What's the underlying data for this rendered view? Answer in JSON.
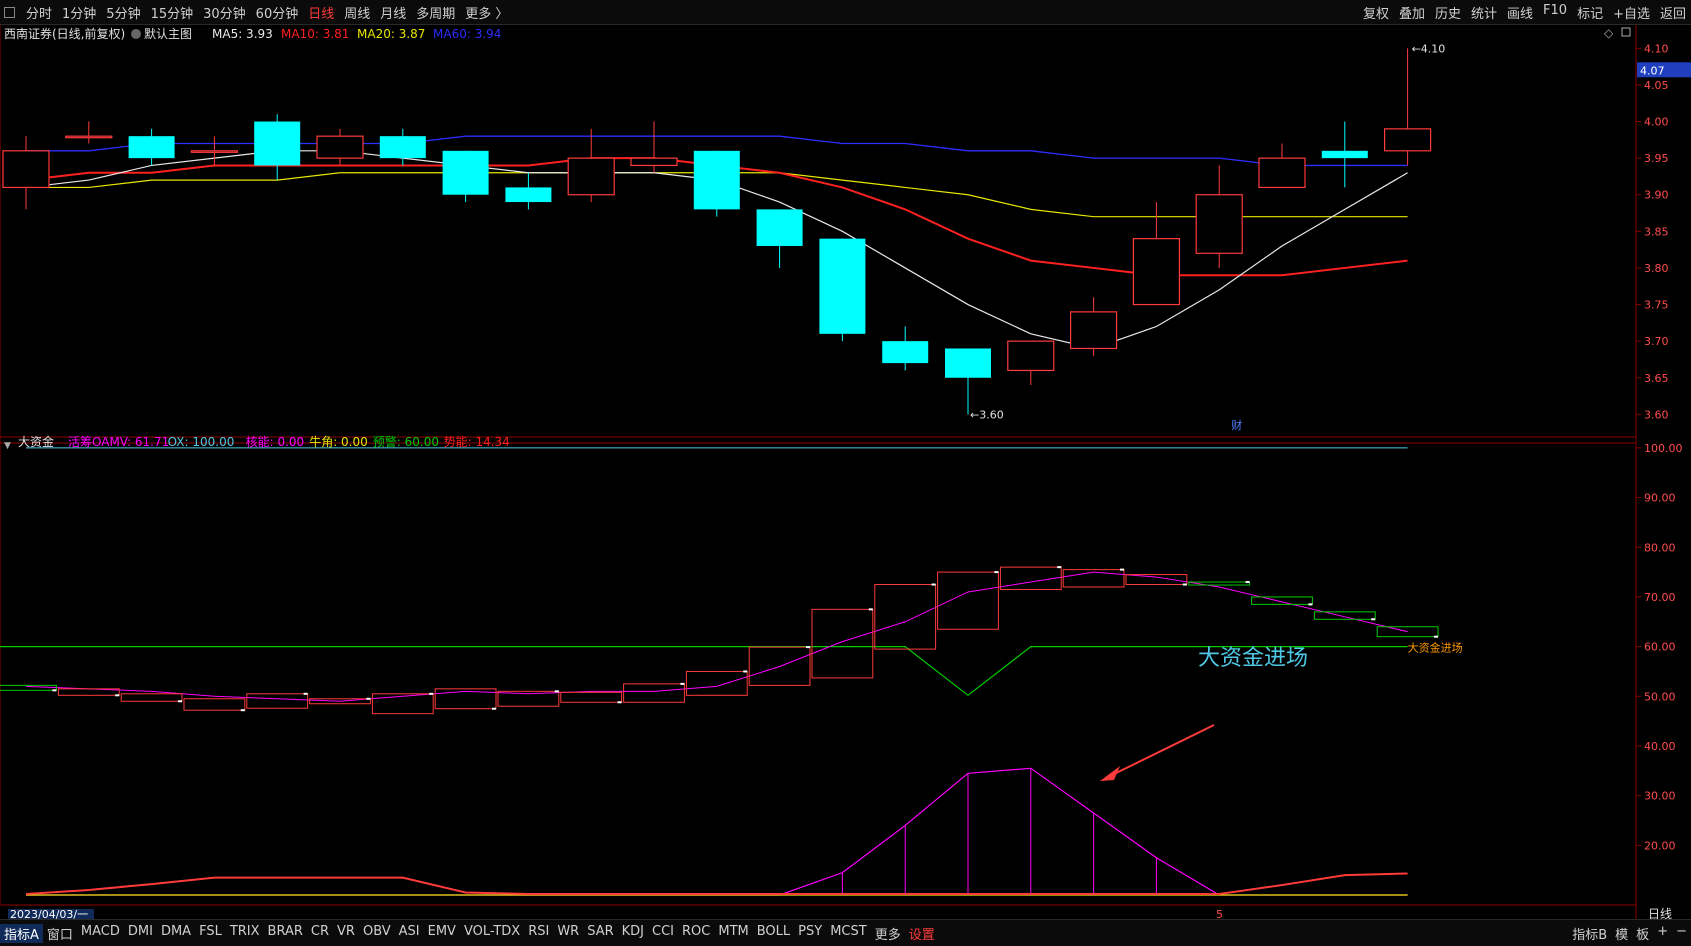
{
  "toolbar": {
    "periods": [
      "分时",
      "1分钟",
      "5分钟",
      "15分钟",
      "30分钟",
      "60分钟",
      "日线",
      "周线",
      "月线",
      "多周期",
      "更多 〉"
    ],
    "active_period": "日线",
    "right_buttons": [
      "复权",
      "叠加",
      "历史",
      "统计",
      "画线",
      "F10",
      "标记",
      "+自选",
      "返回"
    ]
  },
  "indicator_tabs": [
    "指标A",
    "窗口",
    "MACD",
    "DMI",
    "DMA",
    "FSL",
    "TRIX",
    "BRAR",
    "CR",
    "VR",
    "OBV",
    "ASI",
    "EMV",
    "VOL-TDX",
    "RSI",
    "WR",
    "SAR",
    "KDJ",
    "CCI",
    "ROC",
    "MTM",
    "BOLL",
    "PSY",
    "MCST",
    "更多",
    "设置"
  ],
  "bottom_right": [
    "指标B",
    "模",
    "板",
    "+",
    "−"
  ],
  "colors": {
    "up": "#ff3b3b",
    "down": "#00ffff",
    "ma5": "#e8e8e8",
    "ma10": "#ff2020",
    "ma20": "#e6e600",
    "ma60": "#2d2dff",
    "amv": "#ff00ff",
    "green": "#00cc00",
    "orange": "#ff9900",
    "cyanline": "#4fc8e6"
  },
  "chart_data": [
    {
      "type": "candlestick",
      "title": "西南证券(日线,前复权)",
      "subtitle": "默认主图",
      "legend": [
        {
          "name": "MA5",
          "value": "3.93",
          "color": "#e8e8e8"
        },
        {
          "name": "MA10",
          "value": "3.81",
          "color": "#ff2020"
        },
        {
          "name": "MA20",
          "value": "3.87",
          "color": "#e6e600"
        },
        {
          "name": "MA60",
          "value": "3.94",
          "color": "#2d2dff"
        }
      ],
      "ylim": [
        3.58,
        4.11
      ],
      "yticks": [
        "4.10",
        "4.05",
        "4.00",
        "3.95",
        "3.90",
        "3.85",
        "3.80",
        "3.75",
        "3.70",
        "3.65",
        "3.60"
      ],
      "last_price": "4.07",
      "high_label": "4.10",
      "low_label": "3.60",
      "marker": "财",
      "candles": [
        {
          "o": 3.91,
          "h": 3.98,
          "l": 3.88,
          "c": 3.96
        },
        {
          "o": 3.98,
          "h": 4.0,
          "l": 3.97,
          "c": 3.98
        },
        {
          "o": 3.98,
          "h": 3.99,
          "l": 3.94,
          "c": 3.95
        },
        {
          "o": 3.96,
          "h": 3.98,
          "l": 3.94,
          "c": 3.96
        },
        {
          "o": 4.0,
          "h": 4.01,
          "l": 3.92,
          "c": 3.94
        },
        {
          "o": 3.95,
          "h": 3.99,
          "l": 3.94,
          "c": 3.98
        },
        {
          "o": 3.98,
          "h": 3.99,
          "l": 3.94,
          "c": 3.95
        },
        {
          "o": 3.96,
          "h": 3.96,
          "l": 3.89,
          "c": 3.9
        },
        {
          "o": 3.91,
          "h": 3.93,
          "l": 3.88,
          "c": 3.89
        },
        {
          "o": 3.9,
          "h": 3.99,
          "l": 3.89,
          "c": 3.95
        },
        {
          "o": 3.94,
          "h": 4.0,
          "l": 3.93,
          "c": 3.95
        },
        {
          "o": 3.96,
          "h": 3.96,
          "l": 3.87,
          "c": 3.88
        },
        {
          "o": 3.88,
          "h": 3.88,
          "l": 3.8,
          "c": 3.83
        },
        {
          "o": 3.84,
          "h": 3.84,
          "l": 3.7,
          "c": 3.71
        },
        {
          "o": 3.7,
          "h": 3.72,
          "l": 3.66,
          "c": 3.67
        },
        {
          "o": 3.69,
          "h": 3.69,
          "l": 3.6,
          "c": 3.65
        },
        {
          "o": 3.66,
          "h": 3.7,
          "l": 3.64,
          "c": 3.7
        },
        {
          "o": 3.69,
          "h": 3.76,
          "l": 3.68,
          "c": 3.74
        },
        {
          "o": 3.75,
          "h": 3.89,
          "l": 3.75,
          "c": 3.84
        },
        {
          "o": 3.82,
          "h": 3.94,
          "l": 3.8,
          "c": 3.9
        },
        {
          "o": 3.91,
          "h": 3.97,
          "l": 3.91,
          "c": 3.95
        },
        {
          "o": 3.96,
          "h": 4.0,
          "l": 3.91,
          "c": 3.95
        },
        {
          "o": 3.96,
          "h": 4.1,
          "l": 3.94,
          "c": 3.99
        }
      ],
      "ma5": [
        3.91,
        3.92,
        3.94,
        3.95,
        3.96,
        3.96,
        3.95,
        3.94,
        3.93,
        3.93,
        3.93,
        3.92,
        3.89,
        3.85,
        3.8,
        3.75,
        3.71,
        3.69,
        3.72,
        3.77,
        3.83,
        3.88,
        3.93
      ],
      "ma10": [
        3.92,
        3.93,
        3.93,
        3.94,
        3.94,
        3.94,
        3.94,
        3.94,
        3.94,
        3.95,
        3.95,
        3.94,
        3.93,
        3.91,
        3.88,
        3.84,
        3.81,
        3.8,
        3.79,
        3.79,
        3.79,
        3.8,
        3.81
      ],
      "ma20": [
        3.91,
        3.91,
        3.92,
        3.92,
        3.92,
        3.93,
        3.93,
        3.93,
        3.93,
        3.93,
        3.93,
        3.93,
        3.93,
        3.92,
        3.91,
        3.9,
        3.88,
        3.87,
        3.87,
        3.87,
        3.87,
        3.87,
        3.87
      ],
      "ma60": [
        3.96,
        3.96,
        3.97,
        3.97,
        3.97,
        3.97,
        3.97,
        3.98,
        3.98,
        3.98,
        3.98,
        3.98,
        3.98,
        3.97,
        3.97,
        3.96,
        3.96,
        3.95,
        3.95,
        3.95,
        3.94,
        3.94,
        3.94
      ]
    },
    {
      "type": "indicator",
      "title": "大资金",
      "legend": [
        {
          "name": "活筹OAMV",
          "value": "61.71",
          "color": "#ff00ff"
        },
        {
          "name": "OX",
          "value": "100.00",
          "color": "#4fc8e6"
        },
        {
          "name": "核能",
          "value": "0.00",
          "color": "#ff00ff"
        },
        {
          "name": "牛角",
          "value": "0.00",
          "color": "#e6e600"
        },
        {
          "name": "预警",
          "value": "60.00",
          "color": "#00cc00"
        },
        {
          "name": "势能",
          "value": "14.34",
          "color": "#ff2020"
        }
      ],
      "ylim": [
        10,
        103
      ],
      "yticks": [
        "100.00",
        "90.00",
        "80.00",
        "70.00",
        "60.00",
        "50.00",
        "40.00",
        "30.00",
        "20.00"
      ],
      "ox": 100,
      "warning_level": 60,
      "steps": [
        {
          "from": 52.2,
          "to": 51.2,
          "color": "green"
        },
        {
          "from": 51.5,
          "to": 50.2,
          "color": "red"
        },
        {
          "from": 50.5,
          "to": 49.0,
          "color": "red"
        },
        {
          "from": 49.5,
          "to": 47.2,
          "color": "red"
        },
        {
          "from": 47.6,
          "to": 50.5,
          "color": "red"
        },
        {
          "from": 48.5,
          "to": 49.5,
          "color": "red"
        },
        {
          "from": 46.5,
          "to": 50.5,
          "color": "red"
        },
        {
          "from": 51.5,
          "to": 47.5,
          "color": "red"
        },
        {
          "from": 48.0,
          "to": 51.0,
          "color": "red"
        },
        {
          "from": 50.8,
          "to": 48.8,
          "color": "red"
        },
        {
          "from": 48.8,
          "to": 52.5,
          "color": "red"
        },
        {
          "from": 50.2,
          "to": 55.0,
          "color": "red"
        },
        {
          "from": 52.2,
          "to": 59.9,
          "color": "red"
        },
        {
          "from": 53.7,
          "to": 67.5,
          "color": "red"
        },
        {
          "from": 59.5,
          "to": 72.5,
          "color": "red"
        },
        {
          "from": 63.5,
          "to": 75.0,
          "color": "red"
        },
        {
          "from": 71.5,
          "to": 76.0,
          "color": "red"
        },
        {
          "from": 72.0,
          "to": 75.5,
          "color": "red"
        },
        {
          "from": 74.5,
          "to": 72.5,
          "color": "red"
        },
        {
          "from": 72.5,
          "to": 73.0,
          "color": "green"
        },
        {
          "from": 70.0,
          "to": 68.5,
          "color": "green"
        },
        {
          "from": 67.0,
          "to": 65.5,
          "color": "green"
        },
        {
          "from": 64.0,
          "to": 62.0,
          "color": "green"
        }
      ],
      "amv_line": [
        52.0,
        51.5,
        51.0,
        50.0,
        49.5,
        49.0,
        50.0,
        51.0,
        50.5,
        51.0,
        51.0,
        52.0,
        56.0,
        61.0,
        65.0,
        71.0,
        73.0,
        75.0,
        74.0,
        72.0,
        69.0,
        66.0,
        63.0
      ],
      "yujing_dip": [
        60,
        60,
        60,
        60,
        60,
        60,
        60,
        60,
        60,
        60,
        60,
        60,
        60,
        60,
        60,
        50.2,
        60,
        60,
        60,
        60,
        60,
        60,
        60
      ],
      "nengliang": [
        10,
        10,
        10,
        10,
        10,
        10,
        10,
        10,
        10,
        10,
        10,
        10,
        10,
        14.5,
        24,
        34.5,
        35.5,
        26.5,
        17.5,
        10,
        10,
        10,
        10
      ],
      "shineng": [
        10.2,
        11,
        12.2,
        13.5,
        13.5,
        13.5,
        13.5,
        10.5,
        10.2,
        10.2,
        10.2,
        10.2,
        10.2,
        10.2,
        10.2,
        10.2,
        10.2,
        10.2,
        10.2,
        10.2,
        12,
        14,
        14.34
      ],
      "signal_label": "大资金进场",
      "annotation": "大资金进场"
    }
  ],
  "date_label": "2023/04/03/一",
  "date_marker": "5",
  "axis_footer": "日线"
}
